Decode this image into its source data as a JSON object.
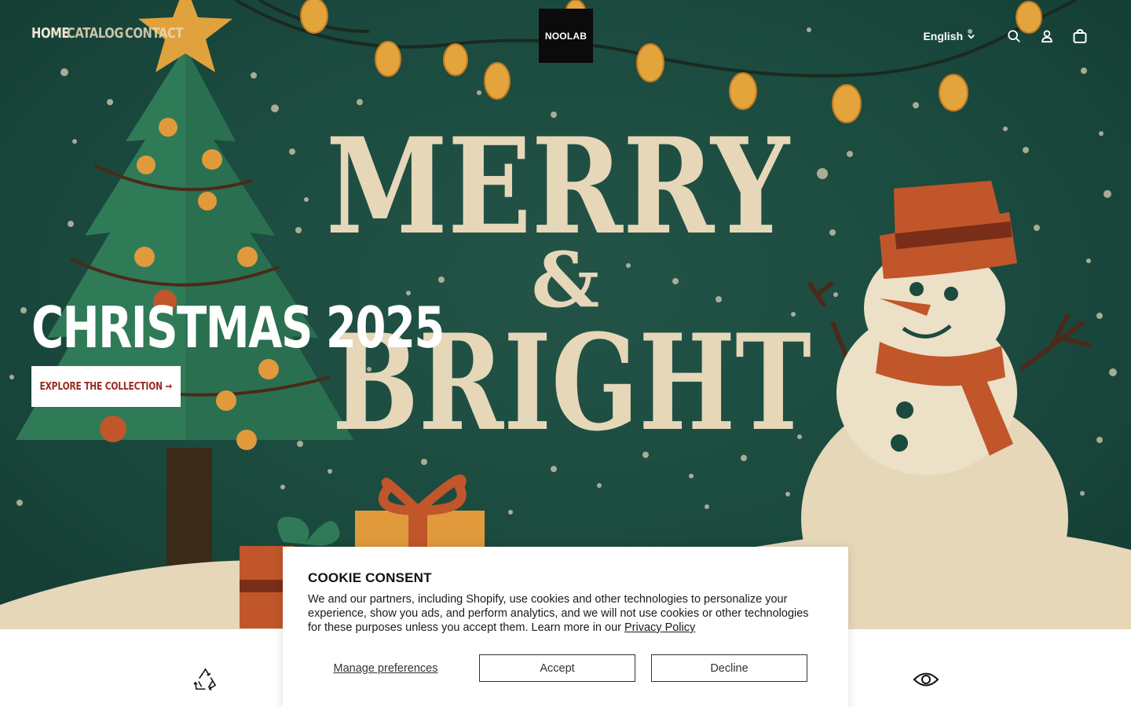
{
  "nav": {
    "items": [
      {
        "label": "HOME"
      },
      {
        "label": "CATALOG"
      },
      {
        "label": "CONTACT"
      }
    ]
  },
  "logo": {
    "text": "NOOLAB"
  },
  "utilities": {
    "language": "English",
    "icons": [
      "search-icon",
      "account-icon",
      "cart-icon"
    ]
  },
  "hero": {
    "title": "CHRISTMAS 2025",
    "cta_label": "EXPLORE THE COLLECTION →",
    "art": {
      "headline_top": "MERRY",
      "headline_amp": "&",
      "headline_bottom": "BRIGHT"
    }
  },
  "features": {
    "icons": [
      "recycle-icon",
      "eye-icon"
    ]
  },
  "cookie": {
    "title": "COOKIE CONSENT",
    "body": "We and our partners, including Shopify, use cookies and other technologies to personalize your experience, show you ads, and perform analytics, and we will not use cookies or other technologies for these purposes unless you accept them. Learn more in our ",
    "link": "Privacy Policy",
    "manage_label": "Manage preferences",
    "accept_label": "Accept",
    "decline_label": "Decline"
  },
  "colors": {
    "hero_green": "#1b4a3f",
    "cream": "#e6d7b9",
    "cta_text": "#9b2a22",
    "orange": "#c0562a"
  }
}
